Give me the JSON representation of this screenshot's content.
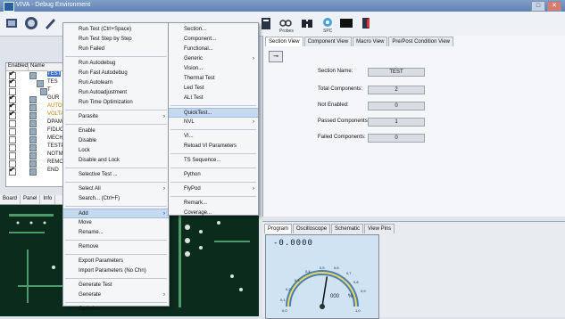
{
  "window": {
    "title": "VIVA - Debug Environment"
  },
  "toolbar": {
    "probes_label": "Probes",
    "spc_label": "SPC"
  },
  "tree": {
    "headers": [
      "Enabled",
      "Name"
    ],
    "rows": [
      {
        "checked": true,
        "name": "TEST"
      },
      {
        "checked": true,
        "name": "TES"
      },
      {
        "checked": false,
        "name": "T"
      },
      {
        "checked": true,
        "name": "GUR"
      },
      {
        "checked": true,
        "name": "AUTO"
      },
      {
        "checked": true,
        "name": "VOLTA"
      },
      {
        "checked": false,
        "name": "DPAMI"
      },
      {
        "checked": false,
        "name": "FIDUC"
      },
      {
        "checked": false,
        "name": "MECH"
      },
      {
        "checked": false,
        "name": "TESTP"
      },
      {
        "checked": false,
        "name": "NOTMI"
      },
      {
        "checked": false,
        "name": "REMOV"
      },
      {
        "checked": true,
        "name": "END"
      }
    ]
  },
  "board_tabs": [
    "Board",
    "Panel",
    "Info"
  ],
  "right_tabs": [
    "Section View",
    "Component View",
    "Macro View",
    "Pre/Post Condition View"
  ],
  "section_view": {
    "fields": [
      {
        "label": "Section Name:",
        "value": "TEST"
      },
      {
        "label": "Total Components:",
        "value": "2"
      },
      {
        "label": "Not Enabled:",
        "value": "0"
      },
      {
        "label": "Passed Components:",
        "value": "1"
      },
      {
        "label": "Failed Components:",
        "value": "0"
      }
    ]
  },
  "bottom_tabs": [
    "Program",
    "Oscilloscope",
    "Schematic",
    "View Pins"
  ],
  "scope": {
    "readout": "-0.0000",
    "scale_labels": [
      "0,5",
      "0,6",
      "0,4",
      "0,7",
      "0,3",
      "0,8",
      "0,2",
      "0,9",
      "0,1",
      "0,0",
      "1,0"
    ],
    "percent": "000",
    "unit": "%",
    "needle_level": 0.55
  },
  "context_menu": {
    "items": [
      {
        "label": "Run Test (Ctrl+Space)"
      },
      {
        "label": "Run Test Step by Step"
      },
      {
        "label": "Run Failed"
      },
      {
        "sep": true
      },
      {
        "label": "Run Autodebug"
      },
      {
        "label": "Run Fast Autodebug"
      },
      {
        "label": "Run Autolearn"
      },
      {
        "label": "Run Autoadjustment"
      },
      {
        "label": "Run Time Optimization"
      },
      {
        "sep": true
      },
      {
        "label": "Parasite",
        "arrow": true
      },
      {
        "sep": true
      },
      {
        "label": "Enable"
      },
      {
        "label": "Disable"
      },
      {
        "label": "Lock"
      },
      {
        "label": "Disable and Lock"
      },
      {
        "sep": true
      },
      {
        "label": "Selective Test ..."
      },
      {
        "sep": true
      },
      {
        "label": "Select All",
        "arrow": true
      },
      {
        "label": "Search... (Ctrl+F)"
      },
      {
        "sep": true
      },
      {
        "label": "Add",
        "arrow": true,
        "highlight": true
      },
      {
        "label": "Move"
      },
      {
        "label": "Rename..."
      },
      {
        "sep": true
      },
      {
        "label": "Remove"
      },
      {
        "sep": true
      },
      {
        "label": "Export Parameters"
      },
      {
        "label": "Import Parameters (No Chn)"
      },
      {
        "sep": true
      },
      {
        "label": "Generate Test"
      },
      {
        "label": "Generate",
        "arrow": true
      },
      {
        "sep": true
      },
      {
        "label": "Optimize"
      }
    ]
  },
  "sub_menu": {
    "items": [
      {
        "label": "Section..."
      },
      {
        "label": "Component..."
      },
      {
        "label": "Functional..."
      },
      {
        "label": "Generic",
        "arrow": true
      },
      {
        "label": "Vision..."
      },
      {
        "label": "Thermal Test"
      },
      {
        "label": "Led Test"
      },
      {
        "label": "ALI Test"
      },
      {
        "sep": true
      },
      {
        "label": "QuickTest...",
        "highlight": true
      },
      {
        "label": "NVL",
        "arrow": true
      },
      {
        "sep": true
      },
      {
        "label": "VI..."
      },
      {
        "label": "Reload VI Parameters"
      },
      {
        "sep": true
      },
      {
        "label": "TS Sequence..."
      },
      {
        "sep": true
      },
      {
        "label": "Python"
      },
      {
        "sep": true
      },
      {
        "label": "FlyPod",
        "arrow": true
      },
      {
        "sep": true
      },
      {
        "label": "Remark..."
      },
      {
        "label": "Coverage..."
      }
    ]
  },
  "colors": {
    "highlight": "#c5d9f1",
    "board": "#0a2a1a",
    "titlebar": "#5f82b4"
  }
}
